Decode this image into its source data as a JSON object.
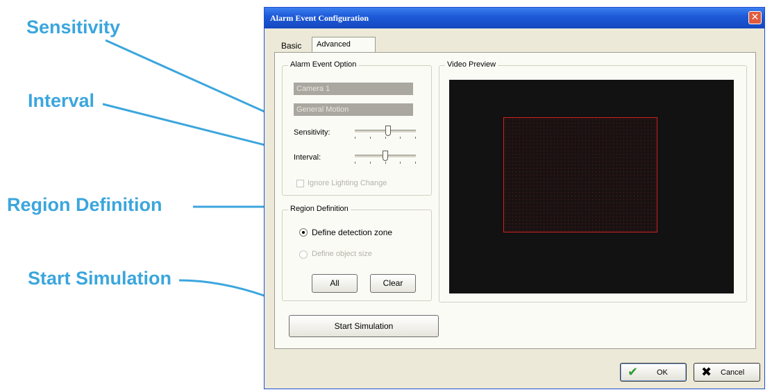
{
  "callouts": {
    "sensitivity": "Sensitivity",
    "interval": "Interval",
    "region_definition": "Region Definition",
    "start_simulation": "Start Simulation"
  },
  "window": {
    "title": "Alarm Event Configuration",
    "close_icon": "close-icon"
  },
  "tabs": {
    "basic": "Basic",
    "advanced": "Advanced"
  },
  "alarm_event_option": {
    "title": "Alarm Event Option",
    "camera": "Camera 1",
    "event_type": "General Motion",
    "sensitivity_label": "Sensitivity:",
    "sensitivity_level": 0.55,
    "interval_label": "Interval:",
    "interval_level": 0.5,
    "ignore_lighting_label": "Ignore Lighting Change"
  },
  "region_definition": {
    "title": "Region Definition",
    "option_zone": "Define detection zone",
    "option_object": "Define object size",
    "all_button": "All",
    "clear_button": "Clear"
  },
  "video_preview": {
    "title": "Video Preview"
  },
  "start_simulation_button": "Start Simulation",
  "footer": {
    "ok_label": "OK",
    "cancel_label": "Cancel"
  },
  "colors": {
    "callout": "#3ba6dd",
    "titlebar": "#1e5bd8",
    "detection_zone_border": "#d62020"
  }
}
